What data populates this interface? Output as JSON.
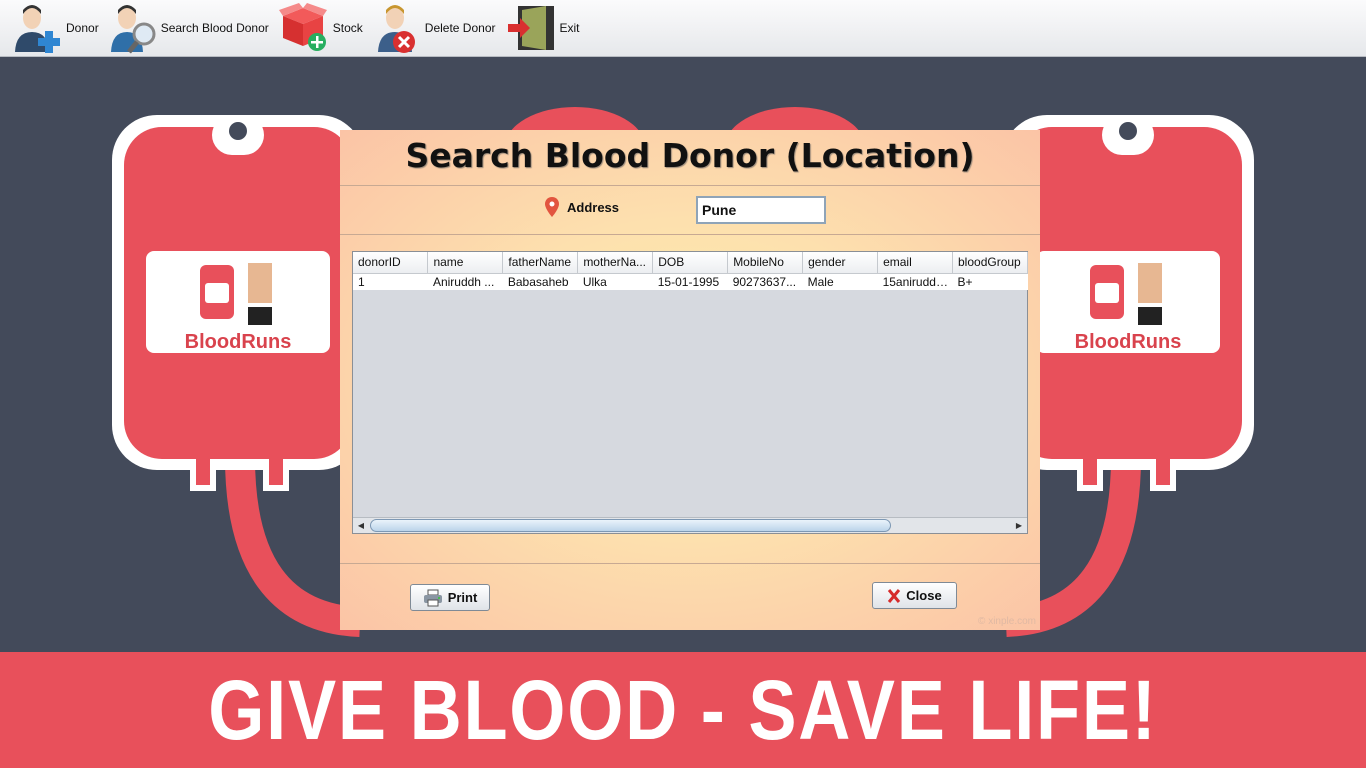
{
  "toolbar": {
    "items": [
      {
        "label": "Donor",
        "icon": "add-donor-icon"
      },
      {
        "label": "Search Blood Donor",
        "icon": "search-donor-icon"
      },
      {
        "label": "Stock",
        "icon": "stock-box-icon"
      },
      {
        "label": "Delete Donor",
        "icon": "delete-donor-icon"
      },
      {
        "label": "Exit",
        "icon": "exit-door-icon"
      }
    ]
  },
  "poster": {
    "brand": "BloodRuns",
    "banner": "GIVE BLOOD - SAVE LIFE!",
    "colors": {
      "background": "#434a5a",
      "blood": "#e8505b"
    }
  },
  "dialog": {
    "title": "Search Blood Donor (Location)",
    "address_label": "Address",
    "address_value": "Pune",
    "table": {
      "columns": [
        "donorID",
        "name",
        "fatherName",
        "motherNa...",
        "DOB",
        "MobileNo",
        "gender",
        "email",
        "bloodGroup"
      ],
      "rows": [
        [
          "1",
          "Aniruddh ...",
          "Babasaheb",
          "Ulka",
          "15-01-1995",
          "90273637...",
          "Male",
          "15aniruddh...",
          "B+"
        ]
      ]
    },
    "print_label": "Print",
    "close_label": "Close",
    "watermark": "© xinple.com"
  }
}
